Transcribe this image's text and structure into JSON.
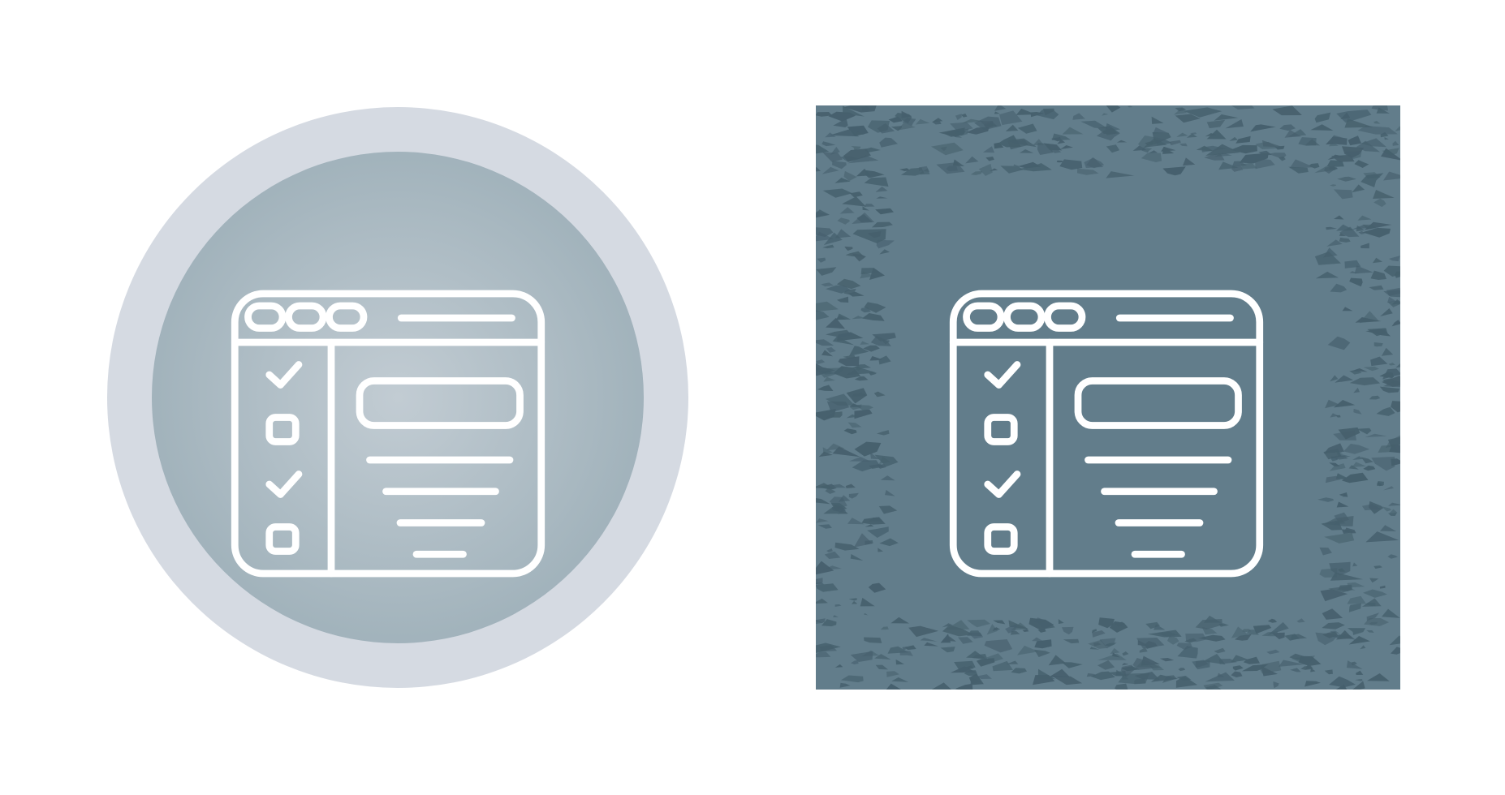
{
  "icons": [
    {
      "name": "checklist-browser-icon",
      "style": "circle-badge",
      "colors": {
        "outer_ring": "#d5dae2",
        "inner_light": "#c2ccd3",
        "inner_dark": "#9eb0b9",
        "line": "#ffffff"
      },
      "checklist": [
        "checked",
        "unchecked",
        "checked",
        "unchecked"
      ]
    },
    {
      "name": "checklist-browser-icon",
      "style": "grunge-square",
      "colors": {
        "background": "#627d8b",
        "texture": "#46606d",
        "line": "#ffffff"
      },
      "checklist": [
        "checked",
        "unchecked",
        "checked",
        "unchecked"
      ]
    }
  ]
}
